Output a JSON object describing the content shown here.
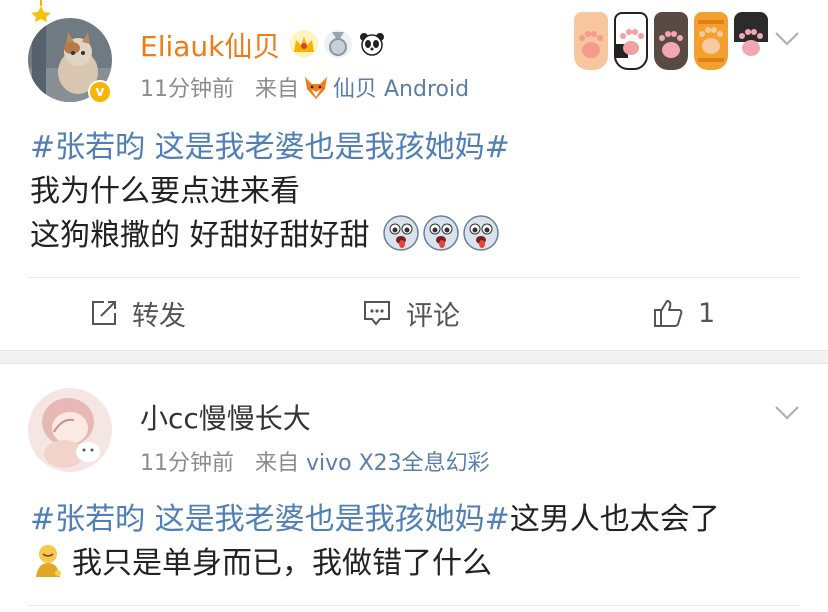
{
  "post1": {
    "username": "Eliauk仙贝",
    "time": "11分钟前",
    "from_prefix": "来自",
    "source": "仙贝 Android",
    "badges": [
      "crown-badge",
      "medal-badge",
      "panda-badge"
    ],
    "hashtag": "#张若昀 这是我老婆也是我孩她妈#",
    "line2": "我为什么要点进来看",
    "line3": "这狗粮撒的 好甜好甜好甜",
    "emojis": [
      "drool-emoji",
      "drool-emoji",
      "drool-emoji"
    ],
    "actions": {
      "repost_label": "转发",
      "comment_label": "评论",
      "like_count": "1"
    }
  },
  "post2": {
    "username": "小cc慢慢长大",
    "time": "11分钟前",
    "from_prefix": "来自",
    "source": "vivo X23全息幻彩",
    "hashtag": "#张若昀 这是我老婆也是我孩她妈#",
    "line1_rest": "这男人也太会了",
    "line2": "我只是单身而已，我做错了什么"
  },
  "colors": {
    "hashtag": "#4f7fb6",
    "vip_username": "#ef7a18",
    "meta": "#8c8c8c",
    "source": "#5a7ea9"
  }
}
